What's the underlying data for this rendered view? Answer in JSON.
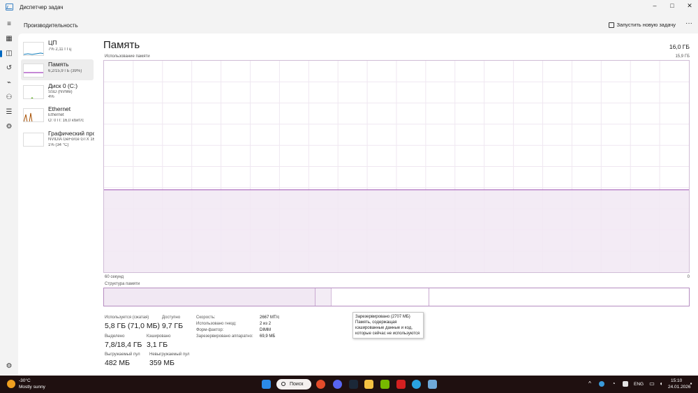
{
  "window": {
    "title": "Диспетчер задач",
    "controls": {
      "minimize": "–",
      "maximize": "□",
      "close": "✕"
    }
  },
  "header": {
    "section_title": "Производительность",
    "run_task_label": "Запустить новую задачу",
    "more_label": "···"
  },
  "rail": [
    {
      "name": "hamburger-menu-icon",
      "glyph": "≡"
    },
    {
      "name": "processes-icon",
      "glyph": "▦"
    },
    {
      "name": "performance-icon",
      "glyph": "◫"
    },
    {
      "name": "history-icon",
      "glyph": "↺"
    },
    {
      "name": "startup-icon",
      "glyph": "⌁"
    },
    {
      "name": "users-icon",
      "glyph": "⚇"
    },
    {
      "name": "details-icon",
      "glyph": "☰"
    },
    {
      "name": "services-icon",
      "glyph": "⚙"
    },
    {
      "name": "settings-icon",
      "glyph": "⚙"
    }
  ],
  "perf_list": [
    {
      "name": "ЦП",
      "sub1": "7% 2,11 ГГц",
      "sub2": "",
      "color": "#117dbb"
    },
    {
      "name": "Память",
      "sub1": "6,2/15,9 ГБ (39%)",
      "sub2": "",
      "color": "#8b12ae"
    },
    {
      "name": "Диск 0 (C:)",
      "sub1": "SSD (NVMe)",
      "sub2": "4%",
      "color": "#4da60c"
    },
    {
      "name": "Ethernet",
      "sub1": "Ethernet",
      "sub2": "О: 0 П: 16,0 кбит/с",
      "color": "#a74f01"
    },
    {
      "name": "Графический про",
      "sub1": "NVIDIA GeForce GTX 16(",
      "sub2": "1% (34 °C)",
      "color": "#ac3d3d"
    }
  ],
  "main": {
    "title": "Память",
    "total": "16,0 ГБ",
    "graph_label": "Использование памяти",
    "graph_max": "15,9 ГБ",
    "axis_left": "60 секунд",
    "axis_right": "0",
    "struct_label": "Структура памяти",
    "usage_fraction": 0.39,
    "struct_segments": {
      "used": 0.362,
      "modified": 0.027,
      "standby": 0.167
    },
    "tooltip": "Зарезервировано (2707 МБ) Память, содержащая кэшированные данные и код, которые сейчас не используются"
  },
  "stats": {
    "in_use_label": "Используется (сжатая)",
    "in_use_value": "5,8 ГБ (71,0 МБ)",
    "available_label": "Доступно",
    "available_value": "9,7 ГБ",
    "committed_label": "Выделено",
    "committed_value": "7,8/18,4 ГБ",
    "cached_label": "Кэшировано",
    "cached_value": "3,1 ГБ",
    "paged_label": "Выгружаемый пул",
    "paged_value": "482 МБ",
    "nonpaged_label": "Невыгружаемый пул",
    "nonpaged_value": "359 МБ"
  },
  "specs": [
    {
      "label": "Скорость:",
      "value": "2667 МТ/с"
    },
    {
      "label": "Использовано гнезд:",
      "value": "2 из 2"
    },
    {
      "label": "Форм-фактор:",
      "value": "DIMM"
    },
    {
      "label": "Зарезервировано аппаратно:",
      "value": "69,9 МБ"
    }
  ],
  "taskbar": {
    "weather_temp": "-30°C",
    "weather_desc": "Mostly sunny",
    "search_label": "Поиск",
    "lang": "ENG",
    "time": "15:10",
    "date": "24.01.2026"
  }
}
